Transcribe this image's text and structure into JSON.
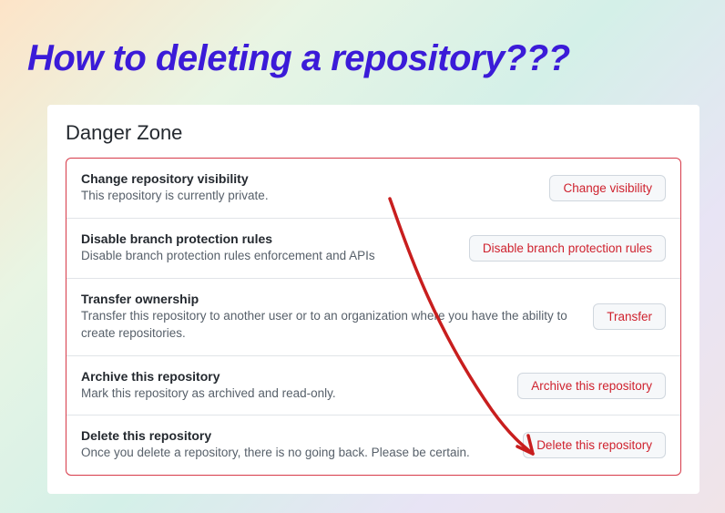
{
  "headline": "How to deleting a repository???",
  "panel": {
    "title": "Danger Zone",
    "items": [
      {
        "title": "Change repository visibility",
        "desc": "This repository is currently private.",
        "button": "Change visibility"
      },
      {
        "title": "Disable branch protection rules",
        "desc": "Disable branch protection rules enforcement and APIs",
        "button": "Disable branch protection rules"
      },
      {
        "title": "Transfer ownership",
        "desc": "Transfer this repository to another user or to an organization where you have the ability to create repositories.",
        "button": "Transfer"
      },
      {
        "title": "Archive this repository",
        "desc": "Mark this repository as archived and read-only.",
        "button": "Archive this repository"
      },
      {
        "title": "Delete this repository",
        "desc": "Once you delete a repository, there is no going back. Please be certain.",
        "button": "Delete this repository"
      }
    ]
  }
}
